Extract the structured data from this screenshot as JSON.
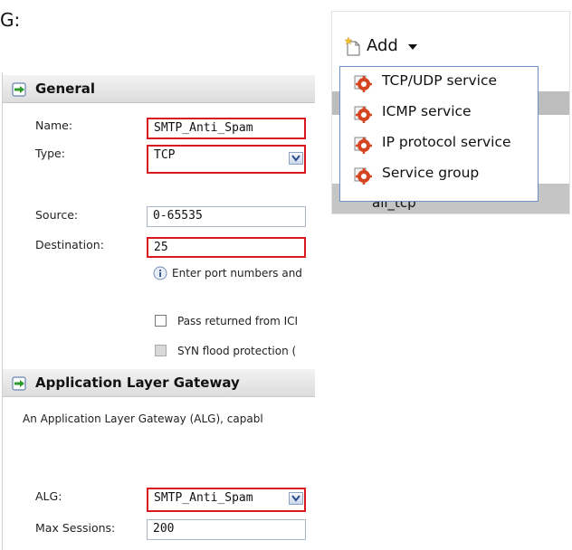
{
  "caption": "G:",
  "general": {
    "title": "General",
    "name_label": "Name:",
    "name_value": "SMTP_Anti_Spam",
    "type_label": "Type:",
    "type_value": "TCP",
    "source_label": "Source:",
    "source_value": "0-65535",
    "destination_label": "Destination:",
    "destination_value": "25",
    "hint": "Enter port numbers and",
    "pass_returned": "Pass returned from ICI",
    "syn_flood": "SYN flood protection ("
  },
  "alg": {
    "title": "Application Layer Gateway",
    "description": "An Application Layer Gateway (ALG), capabl",
    "alg_label": "ALG:",
    "alg_value": "SMTP_Anti_Spam",
    "max_sessions_label": "Max Sessions:",
    "max_sessions_value": "200"
  },
  "add_menu": {
    "button_label": "Add",
    "items": [
      {
        "label": "TCP/UDP service",
        "icon": "service-gear-icon"
      },
      {
        "label": "ICMP service",
        "icon": "service-gear-icon"
      },
      {
        "label": "IP protocol service",
        "icon": "service-gear-icon"
      },
      {
        "label": "Service group",
        "icon": "service-gear-icon"
      }
    ],
    "peek_item": "all_tcp"
  },
  "colors": {
    "highlight": "#d71920",
    "field_border": "#a9b7c8",
    "menu_border": "#6d8fc7",
    "icon_red": "#d64522"
  }
}
